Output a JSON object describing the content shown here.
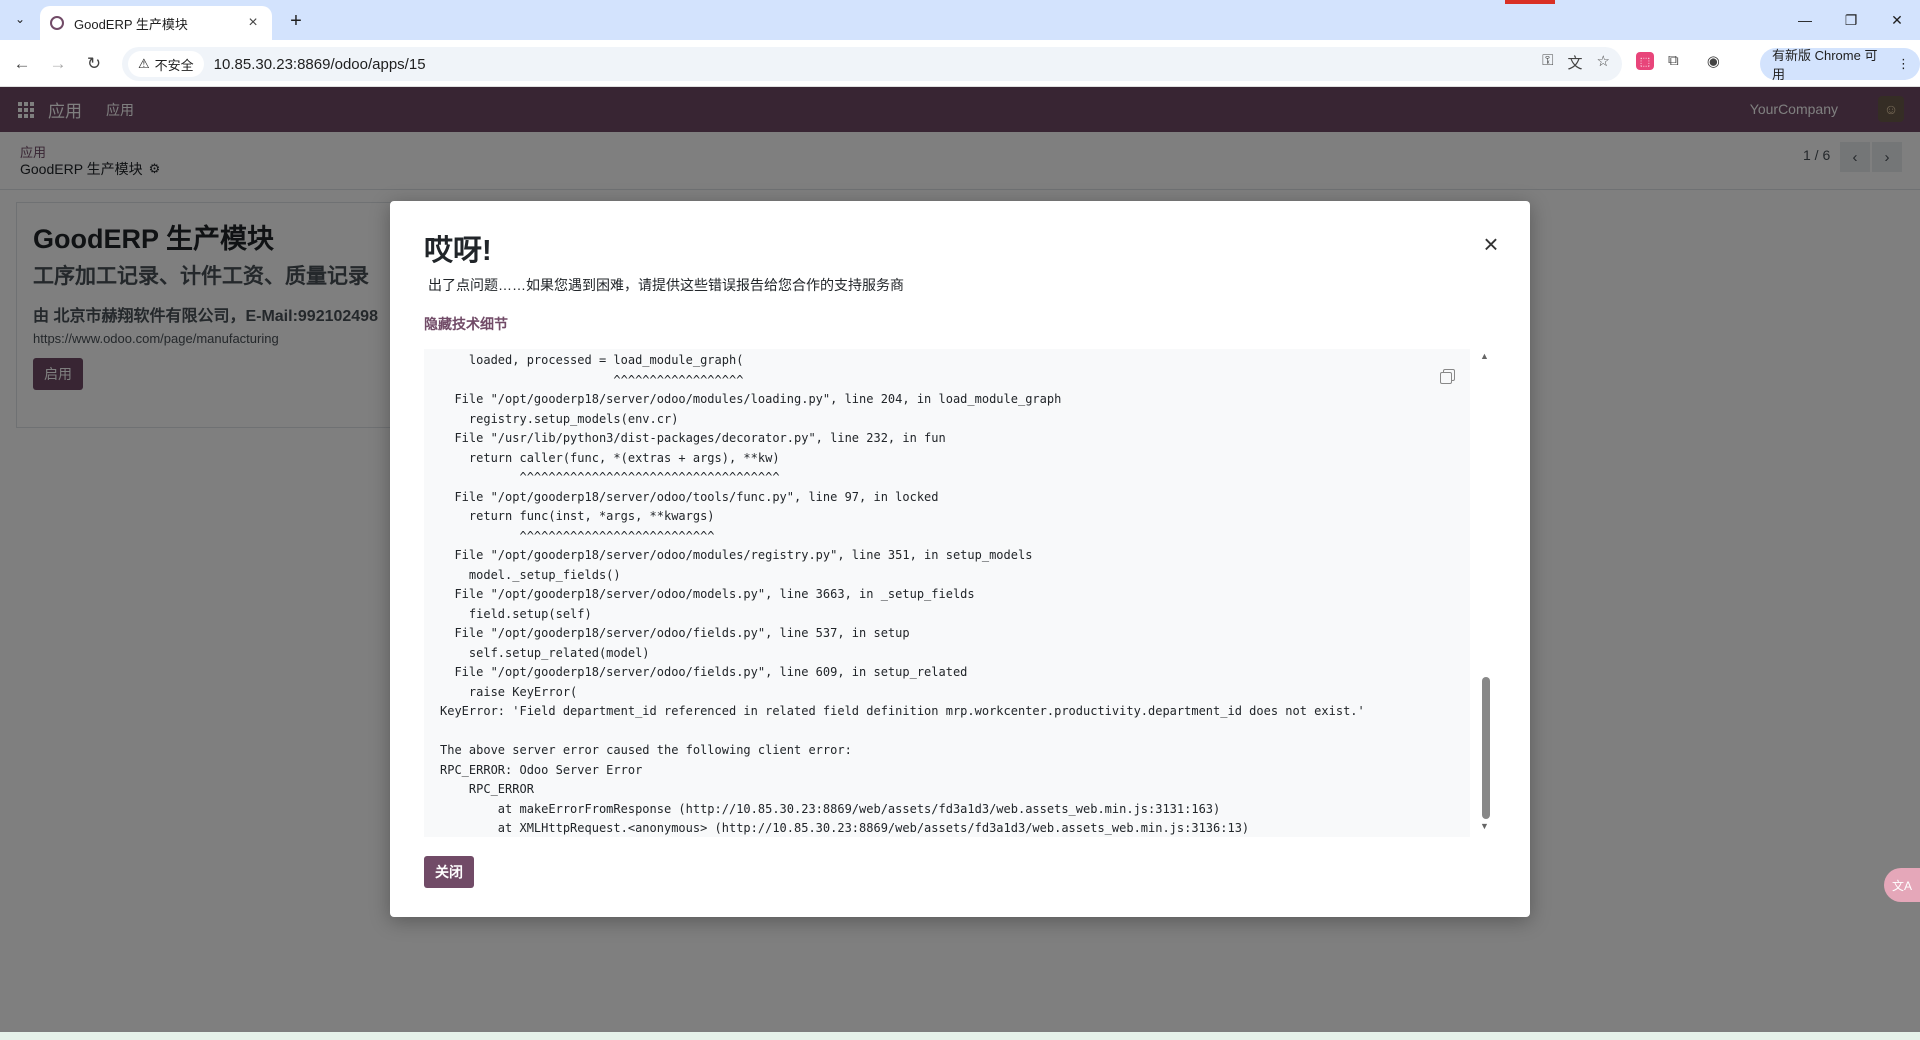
{
  "browser": {
    "tab_title": "GoodERP 生产模块",
    "url": "10.85.30.23:8869/odoo/apps/15",
    "security_label": "不安全",
    "chrome_available": "有新版 Chrome 可用"
  },
  "navbar": {
    "brand": "应用",
    "menu_item": "应用",
    "company": "YourCompany"
  },
  "control_panel": {
    "breadcrumb_parent": "应用",
    "breadcrumb_current": "GoodERP 生产模块",
    "pager_value": "1 / 6"
  },
  "app_sheet": {
    "title": "GoodERP 生产模块",
    "summary": "工序加工记录、计件工资、质量记录",
    "author": "由 北京市赫翔软件有限公司，E-Mail:992102498",
    "website": "https://www.odoo.com/page/manufacturing",
    "activate_label": "启用"
  },
  "error_dialog": {
    "title": "哎呀!",
    "message": "出了点问题……如果您遇到困难，请提供这些错误报告给您合作的支持服务商",
    "toggle_label": "隐藏技术细节",
    "close_label": "关闭",
    "traceback_lines": [
      "    loaded, processed = load_module_graph(",
      "                        ^^^^^^^^^^^^^^^^^^",
      "  File \"/opt/gooderp18/server/odoo/modules/loading.py\", line 204, in load_module_graph",
      "    registry.setup_models(env.cr)",
      "  File \"/usr/lib/python3/dist-packages/decorator.py\", line 232, in fun",
      "    return caller(func, *(extras + args), **kw)",
      "           ^^^^^^^^^^^^^^^^^^^^^^^^^^^^^^^^^^^^",
      "  File \"/opt/gooderp18/server/odoo/tools/func.py\", line 97, in locked",
      "    return func(inst, *args, **kwargs)",
      "           ^^^^^^^^^^^^^^^^^^^^^^^^^^^",
      "  File \"/opt/gooderp18/server/odoo/modules/registry.py\", line 351, in setup_models",
      "    model._setup_fields()",
      "  File \"/opt/gooderp18/server/odoo/models.py\", line 3663, in _setup_fields",
      "    field.setup(self)",
      "  File \"/opt/gooderp18/server/odoo/fields.py\", line 537, in setup",
      "    self.setup_related(model)",
      "  File \"/opt/gooderp18/server/odoo/fields.py\", line 609, in setup_related",
      "    raise KeyError(",
      "KeyError: 'Field department_id referenced in related field definition mrp.workcenter.productivity.department_id does not exist.'",
      "",
      "The above server error caused the following client error:",
      "RPC_ERROR: Odoo Server Error",
      "    RPC_ERROR",
      "        at makeErrorFromResponse (http://10.85.30.23:8869/web/assets/fd3a1d3/web.assets_web.min.js:3131:163)",
      "        at XMLHttpRequest.<anonymous> (http://10.85.30.23:8869/web/assets/fd3a1d3/web.assets_web.min.js:3136:13)"
    ]
  },
  "icons": {
    "favicon": "odoo-favicon-icon",
    "apps": "apps-grid-icon",
    "settings": "gear-icon",
    "copy": "copy-icon",
    "close": "close-icon"
  },
  "colors": {
    "brand": "#714b67",
    "tabbar": "#d3e3fd",
    "backdrop": "rgba(0,0,0,0.5)"
  }
}
